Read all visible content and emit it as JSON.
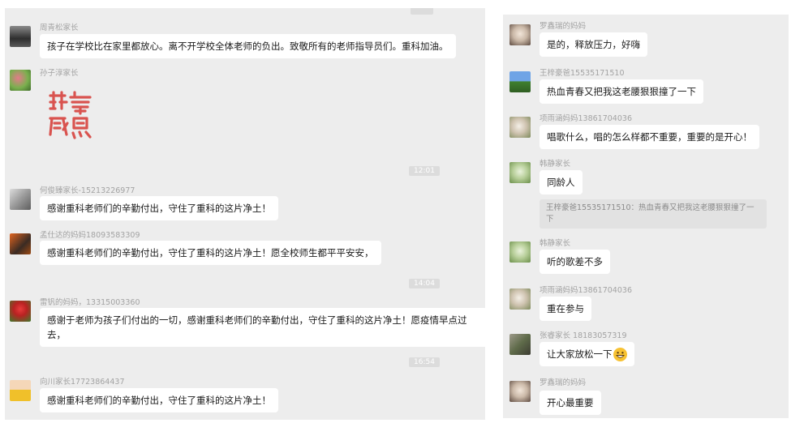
{
  "left": {
    "messages": [
      {
        "sender": "周青松家长",
        "text": "孩子在学校比在家里都放心。离不开学校全体老师的负出。致敬所有的老师指导员们。重科加油。"
      },
      {
        "sender": "孙子淳家长",
        "sticker_text": "非常感恩"
      },
      {
        "sender": "何俊臻家长-15213226977",
        "text": "感谢重科老师们的辛勤付出，守住了重科的这片净土！"
      },
      {
        "sender": "孟仕达的妈妈18093583309",
        "text": "感谢重科老师们的辛勤付出，守住了重科的这片净土！愿全校师生都平平安安，"
      },
      {
        "sender": "雷钒的妈妈，13315003360",
        "text": "感谢于老师为孩子们付出的一切，感谢重科老师们的辛勤付出，守住了重科的这片净土！愿疫情早点过去，"
      },
      {
        "sender": "向川家长17723864437",
        "text": "感谢重科老师们的辛勤付出，守住了重科的这片净土！"
      }
    ],
    "times": [
      "12:01",
      "14:04",
      "16:54"
    ]
  },
  "right": {
    "messages": [
      {
        "sender": "罗鑫瑞的妈妈",
        "text": "是的，释放压力，好嗨"
      },
      {
        "sender": "王梓豪爸15535171510",
        "text": "热血青春又把我这老腰狠狠撞了一下"
      },
      {
        "sender": "项雨涵妈妈13861704036",
        "text": "唱歌什么，唱的怎么样都不重要，重要的是开心！"
      },
      {
        "sender": "韩静家长",
        "text": "同龄人",
        "quote": "王梓豪爸15535171510：热血青春又把我这老腰狠狠撞了一下"
      },
      {
        "sender": "韩静家长",
        "text": "听的歌差不多"
      },
      {
        "sender": "项雨涵妈妈13861704036",
        "text": "重在参与"
      },
      {
        "sender": "张睿家长 18183057319",
        "text": "让大家放松一下"
      },
      {
        "sender": "罗鑫瑞的妈妈",
        "text": "开心最重要"
      }
    ]
  },
  "colors": {
    "panel_bg": "#ededed",
    "bubble_bg": "#ffffff",
    "sticker_red": "#d9534f"
  }
}
